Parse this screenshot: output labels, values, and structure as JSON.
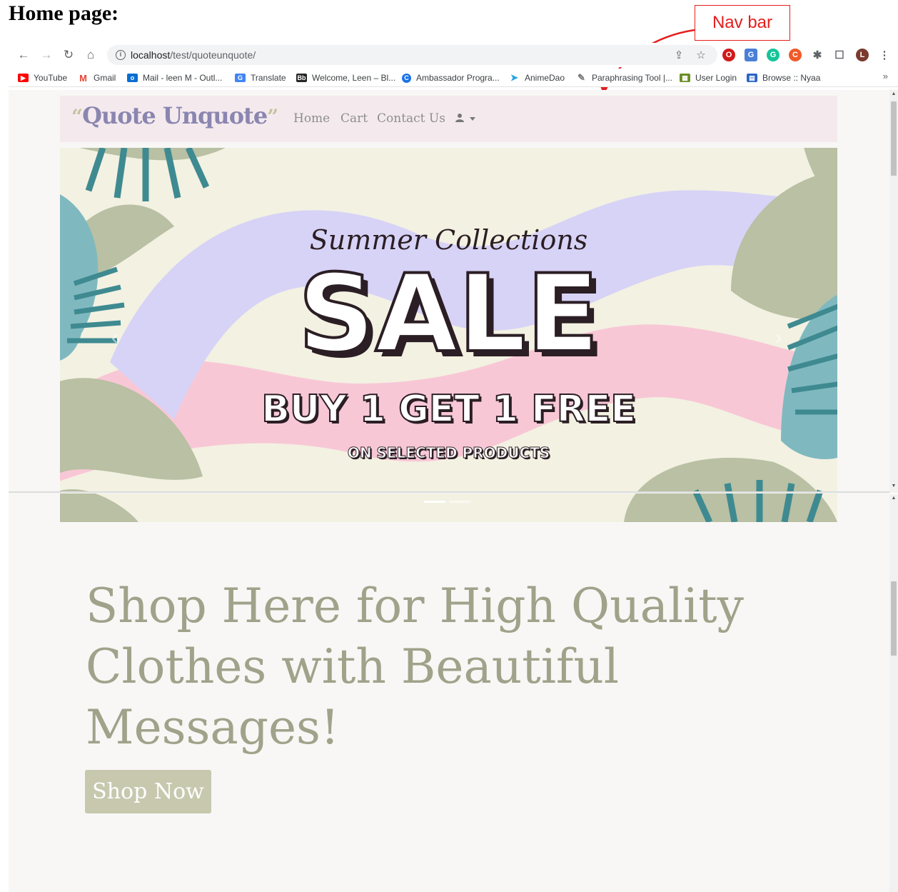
{
  "heading": "Home page:",
  "callout": {
    "label": "Nav bar"
  },
  "browser": {
    "url_host": "localhost",
    "url_path": "/test/quoteunquote/",
    "bookmarks": [
      {
        "label": "YouTube",
        "icon": "youtube-icon",
        "color": "#ff0000"
      },
      {
        "label": "Gmail",
        "icon": "gmail-icon",
        "color": "#ea4335"
      },
      {
        "label": "Mail - leen M - Outl...",
        "icon": "outlook-icon",
        "color": "#0a6ed1"
      },
      {
        "label": "Translate",
        "icon": "translate-icon",
        "color": "#4285f4"
      },
      {
        "label": "Welcome, Leen – Bl...",
        "icon": "blackboard-icon",
        "color": "#262626"
      },
      {
        "label": "Ambassador Progra...",
        "icon": "ambassador-icon",
        "color": "#1a73e8"
      },
      {
        "label": "AnimeDao",
        "icon": "telegram-icon",
        "color": "#2aa3df"
      },
      {
        "label": "Paraphrasing Tool |...",
        "icon": "feather-icon",
        "color": "#777777"
      },
      {
        "label": "User Login",
        "icon": "user-login-icon",
        "color": "#6b8e23"
      },
      {
        "label": "Browse :: Nyaa",
        "icon": "nyaa-icon",
        "color": "#2a66c8"
      }
    ],
    "bookmarks_overflow": "»",
    "profile_initial": "L"
  },
  "site": {
    "brand": "Quote Unquote",
    "nav": [
      "Home",
      "Cart",
      "Contact Us"
    ],
    "colors": {
      "brand": "#8a86b0",
      "navbar_bg": "#f4eaee",
      "button_bg": "#c7c8ae",
      "hero_text": "#a0a28a"
    }
  },
  "carousel": {
    "script_text": "Summer Collections",
    "headline": "SALE",
    "offer": "BUY 1 GET 1 FREE",
    "note": "ON SELECTED PRODUCTS",
    "indicator_count": 2,
    "active_index": 0
  },
  "hero": {
    "title": "Shop Here for High Quality Clothes with Beautiful Messages!",
    "button": "Shop Now"
  }
}
